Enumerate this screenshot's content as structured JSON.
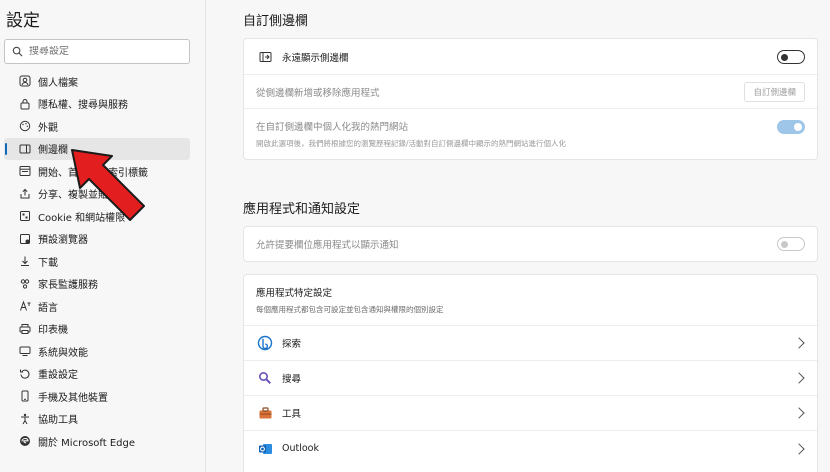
{
  "sidebar": {
    "title": "設定",
    "search_placeholder": "搜尋設定",
    "items": [
      {
        "label": "個人檔案",
        "icon": "profile-icon"
      },
      {
        "label": "隱私權、搜尋與服務",
        "icon": "lock-icon"
      },
      {
        "label": "外觀",
        "icon": "appearance-icon"
      },
      {
        "label": "側邊欄",
        "icon": "sidebar-icon",
        "active": true
      },
      {
        "label": "開始、首頁及新索引標籤",
        "icon": "start-icon"
      },
      {
        "label": "分享、複製並貼上",
        "icon": "share-icon"
      },
      {
        "label": "Cookie 和網站權限",
        "icon": "cookie-icon"
      },
      {
        "label": "預設瀏覽器",
        "icon": "browser-icon"
      },
      {
        "label": "下載",
        "icon": "download-icon"
      },
      {
        "label": "家長監護服務",
        "icon": "family-icon"
      },
      {
        "label": "語言",
        "icon": "language-icon"
      },
      {
        "label": "印表機",
        "icon": "printer-icon"
      },
      {
        "label": "系統與效能",
        "icon": "system-icon"
      },
      {
        "label": "重設設定",
        "icon": "reset-icon"
      },
      {
        "label": "手機及其他裝置",
        "icon": "phone-icon"
      },
      {
        "label": "協助工具",
        "icon": "accessibility-icon"
      },
      {
        "label": "關於 Microsoft Edge",
        "icon": "edge-icon"
      }
    ]
  },
  "main": {
    "section1_title": "自訂側邊欄",
    "always_show_label": "永遠顯示側邊欄",
    "always_show_toggle": "off",
    "add_remove_label": "從側邊欄新增或移除應用程式",
    "customize_button": "自訂側邊欄",
    "personalize_label": "在自訂側邊欄中個人化我的熱門網站",
    "personalize_desc": "開啟此選項後，我們將根據您的瀏覽歷程記錄/活動對自訂側邊欄中顯示的熱門網站進行個人化",
    "personalize_toggle": "on-disabled",
    "section2_title": "應用程式和通知設定",
    "allow_notify_label": "允許提要欄位應用程式以顯示通知",
    "allow_notify_toggle": "off-disabled",
    "app_specific_title": "應用程式特定設定",
    "app_specific_desc": "每個應用程式都包含可設定並包含通知與權限的個別設定",
    "apps": [
      {
        "label": "探索",
        "icon": "discover-icon"
      },
      {
        "label": "搜尋",
        "icon": "search-icon"
      },
      {
        "label": "工具",
        "icon": "tools-icon"
      },
      {
        "label": "Outlook",
        "icon": "outlook-icon"
      }
    ]
  },
  "colors": {
    "accent": "#0f6cbd",
    "arrow": "#e31e1e"
  }
}
